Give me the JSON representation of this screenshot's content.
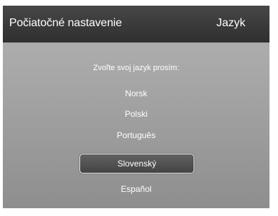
{
  "header": {
    "title": "Počiatočné nastavenie",
    "section": "Jazyk"
  },
  "prompt": "Zvoľte svoj jazyk prosím:",
  "languages": [
    {
      "label": "Norsk",
      "selected": false
    },
    {
      "label": "Polski",
      "selected": false
    },
    {
      "label": "Português",
      "selected": false
    },
    {
      "label": "Slovenský",
      "selected": true
    },
    {
      "label": "Español",
      "selected": false
    }
  ],
  "colors": {
    "header_bg": "#3a3a3a",
    "body_bg": "#a4a4a4",
    "text": "#ffffff",
    "selected_bg": "#505050",
    "selected_border": "#e8e8e8"
  }
}
